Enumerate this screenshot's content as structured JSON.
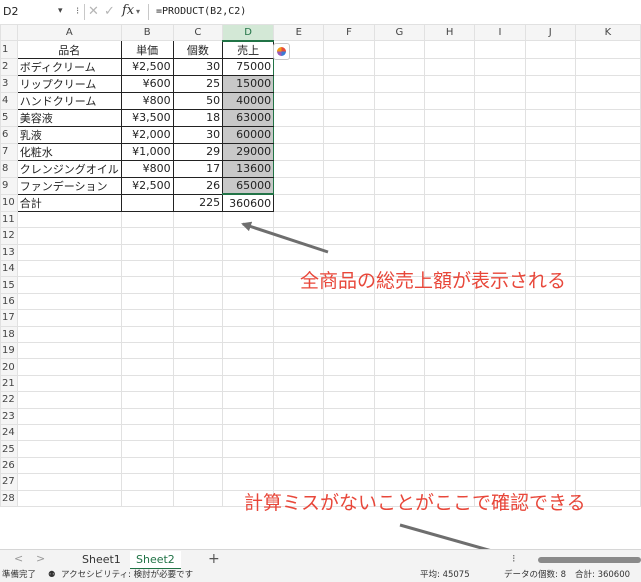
{
  "formula_bar": {
    "name_box": "D2",
    "sep_icon": "⁝",
    "cancel_icon": "✕",
    "enter_icon": "✓",
    "fx_label": "fx",
    "formula": "=PRODUCT(B2,C2)"
  },
  "columns": [
    "A",
    "B",
    "C",
    "D",
    "E",
    "F",
    "G",
    "H",
    "I",
    "J",
    "K"
  ],
  "row_numbers": [
    "1",
    "2",
    "3",
    "4",
    "5",
    "6",
    "7",
    "8",
    "9",
    "10",
    "11",
    "12",
    "13",
    "14",
    "15",
    "16",
    "17",
    "18",
    "19",
    "20",
    "21",
    "22",
    "23",
    "24",
    "25",
    "26",
    "27",
    "28"
  ],
  "table": {
    "headers": [
      "品名",
      "単価",
      "個数",
      "売上"
    ],
    "rows": [
      [
        "ボディクリーム",
        "¥2,500",
        "30",
        "75000"
      ],
      [
        "リップクリーム",
        "¥600",
        "25",
        "15000"
      ],
      [
        "ハンドクリーム",
        "¥800",
        "50",
        "40000"
      ],
      [
        "美容液",
        "¥3,500",
        "18",
        "63000"
      ],
      [
        "乳液",
        "¥2,000",
        "30",
        "60000"
      ],
      [
        "化粧水",
        "¥1,000",
        "29",
        "29000"
      ],
      [
        "クレンジングオイル",
        "¥800",
        "17",
        "13600"
      ],
      [
        "ファンデーション",
        "¥2,500",
        "26",
        "65000"
      ]
    ],
    "total": [
      "合計",
      "",
      "225",
      "360600"
    ]
  },
  "annotations": {
    "total_note": "全商品の総売上額が表示される",
    "status_note": "計算ミスがないことがここで確認できる",
    "color": "#e8473a"
  },
  "sheet_tabs": {
    "prev": "<",
    "next": ">",
    "tabs": [
      "Sheet1",
      "Sheet2"
    ],
    "active": "Sheet2",
    "add": "+",
    "more": "⁝"
  },
  "status_bar": {
    "ready": "準備完了",
    "accessibility": "アクセシビリティ: 検討が必要です",
    "average": "平均: 45075",
    "count": "データの個数: 8",
    "sum": "合計: 360600"
  },
  "accent_color": "#217346"
}
